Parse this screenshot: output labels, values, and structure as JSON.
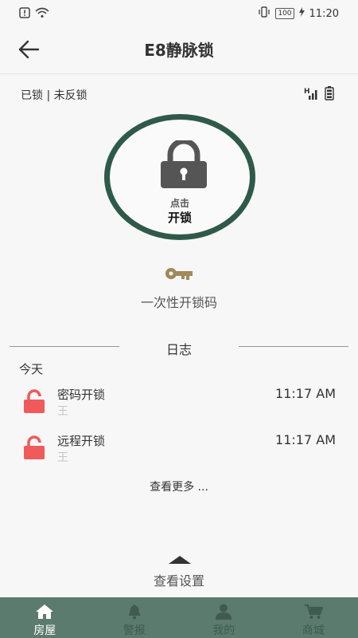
{
  "status_bar": {
    "time": "11:20",
    "battery": "100"
  },
  "header": {
    "title": "E8静脉锁"
  },
  "lock_status": "已锁 | 未反锁",
  "lock_button": {
    "tap": "点击",
    "action": "开锁"
  },
  "one_time_code": "一次性开锁码",
  "log": {
    "title": "日志",
    "day": "今天",
    "entries": [
      {
        "event": "密码开锁",
        "user": "王",
        "time": "11:17 AM"
      },
      {
        "event": "远程开锁",
        "user": "王",
        "time": "11:17 AM"
      }
    ],
    "more": "查看更多 ..."
  },
  "settings_label": "查看设置",
  "nav": [
    {
      "label": "房屋",
      "icon": "home-icon",
      "active": true
    },
    {
      "label": "警报",
      "icon": "bell-icon",
      "active": false
    },
    {
      "label": "我的",
      "icon": "person-icon",
      "active": false
    },
    {
      "label": "商城",
      "icon": "cart-icon",
      "active": false
    }
  ],
  "colors": {
    "ring": "#2f5a4a",
    "nav_bg": "#5c7b6f",
    "unlock_icon": "#f05a5a",
    "key_icon": "#a08a5c"
  }
}
